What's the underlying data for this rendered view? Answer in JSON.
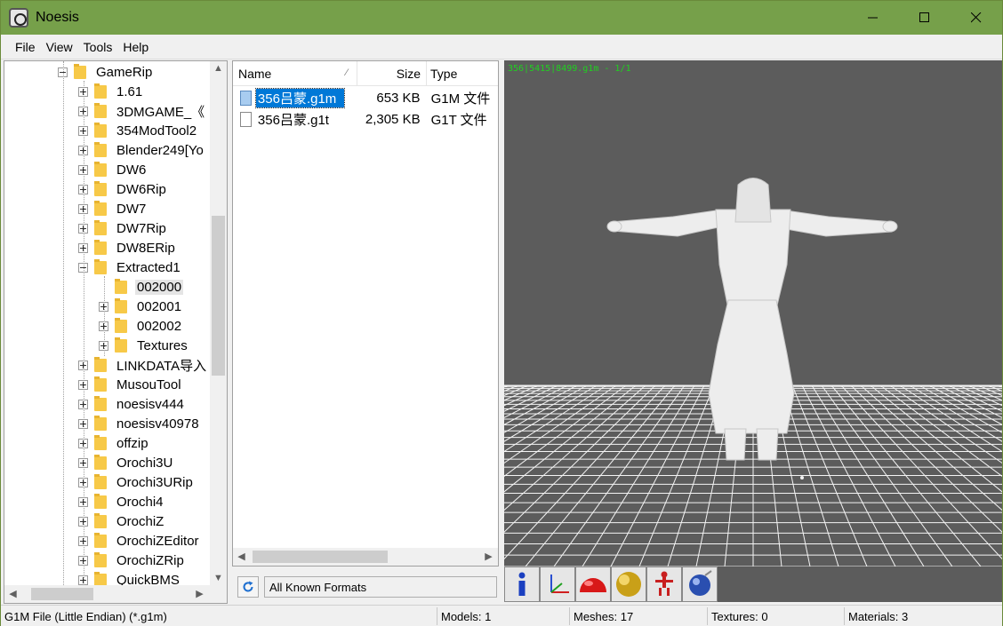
{
  "window": {
    "title": "Noesis",
    "title_color": "#76a04a"
  },
  "menu": {
    "file": "File",
    "view": "View",
    "tools": "Tools",
    "help": "Help"
  },
  "tree": {
    "items": [
      {
        "label": "GameRip",
        "expander": "minus"
      },
      {
        "label": "1.61",
        "expander": "plus"
      },
      {
        "label": "3DMGAME_《",
        "expander": "plus"
      },
      {
        "label": "354ModTool2",
        "expander": "plus"
      },
      {
        "label": "Blender249[Yo",
        "expander": "plus"
      },
      {
        "label": "DW6",
        "expander": "plus"
      },
      {
        "label": "DW6Rip",
        "expander": "plus"
      },
      {
        "label": "DW7",
        "expander": "plus"
      },
      {
        "label": "DW7Rip",
        "expander": "plus"
      },
      {
        "label": "DW8ERip",
        "expander": "plus"
      },
      {
        "label": "Extracted1",
        "expander": "minus"
      },
      {
        "label": "002000",
        "expander": "none",
        "selected": true
      },
      {
        "label": "002001",
        "expander": "plus"
      },
      {
        "label": "002002",
        "expander": "plus"
      },
      {
        "label": "Textures",
        "expander": "plus"
      },
      {
        "label": "LINKDATA导入",
        "expander": "plus"
      },
      {
        "label": "MusouTool",
        "expander": "plus"
      },
      {
        "label": "noesisv444",
        "expander": "plus"
      },
      {
        "label": "noesisv40978",
        "expander": "plus"
      },
      {
        "label": "offzip",
        "expander": "plus"
      },
      {
        "label": "Orochi3U",
        "expander": "plus"
      },
      {
        "label": "Orochi3URip",
        "expander": "plus"
      },
      {
        "label": "Orochi4",
        "expander": "plus"
      },
      {
        "label": "OrochiZ",
        "expander": "plus"
      },
      {
        "label": "OrochiZEditor",
        "expander": "plus"
      },
      {
        "label": "OrochiZRip",
        "expander": "plus"
      },
      {
        "label": "QuickBMS",
        "expander": "plus"
      }
    ]
  },
  "file_list": {
    "columns": {
      "name": "Name",
      "size": "Size",
      "type": "Type"
    },
    "files": [
      {
        "name": "356吕蒙.g1m",
        "size": "653 KB",
        "type": "G1M 文件",
        "selected": true,
        "icon": "model-file-icon"
      },
      {
        "name": "356吕蒙.g1t",
        "size": "2,305 KB",
        "type": "G1T 文件",
        "selected": false,
        "icon": "file-icon"
      }
    ],
    "format_filter": "All Known Formats"
  },
  "viewport": {
    "info": "356|5415|8499.g1m - 1/1",
    "background": "#5c5c5c",
    "tools": [
      "info-icon",
      "axes-icon",
      "red-dome-icon",
      "gold-sphere-icon",
      "skeleton-icon",
      "blue-sphere-icon"
    ]
  },
  "status": {
    "format": "G1M File (Little Endian) (*.g1m)",
    "models": "Models: 1",
    "meshes": "Meshes: 17",
    "textures": "Textures: 0",
    "materials": "Materials: 3"
  }
}
